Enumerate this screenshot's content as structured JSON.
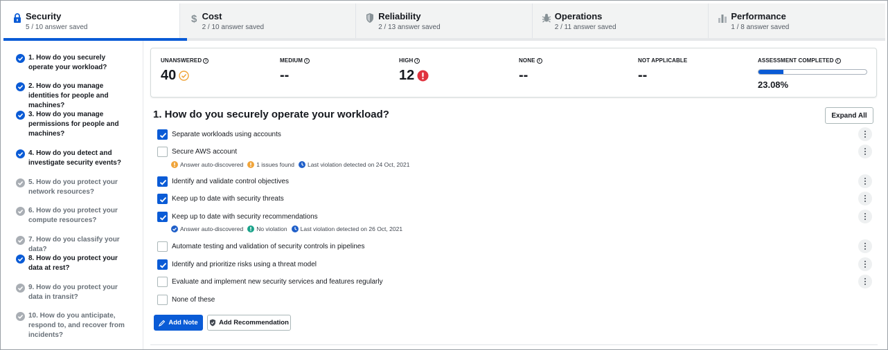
{
  "tabs": [
    {
      "title": "Security",
      "sub": "5 / 10 answer saved",
      "icon": "lock-icon"
    },
    {
      "title": "Cost",
      "sub": "2 / 10 answer saved",
      "icon": "dollar-icon"
    },
    {
      "title": "Reliability",
      "sub": "2 / 13 answer saved",
      "icon": "shield-icon"
    },
    {
      "title": "Operations",
      "sub": "2 / 11 answer saved",
      "icon": "gear-bug-icon"
    },
    {
      "title": "Performance",
      "sub": "1 / 8 answer saved",
      "icon": "bar-chart-icon"
    }
  ],
  "sidebar": {
    "questions": [
      {
        "text": "1. How do you securely operate your workload?",
        "done": true
      },
      {
        "text": "2. How do you manage identities for people and machines?",
        "done": true
      },
      {
        "text": "3. How do you manage permissions for people and machines?",
        "done": true
      },
      {
        "text": "4. How do you detect and investigate security events?",
        "done": true
      },
      {
        "text": "5. How do you protect your network resources?",
        "done": false
      },
      {
        "text": "6. How do you protect your compute resources?",
        "done": false
      },
      {
        "text": "7. How do you classify your data?",
        "done": false
      },
      {
        "text": "8. How do you protect your data at rest?",
        "done": true
      },
      {
        "text": "9. How do you protect your data in transit?",
        "done": false
      },
      {
        "text": "10. How do you anticipate, respond to, and recover from incidents?",
        "done": false
      }
    ]
  },
  "summary": {
    "unanswered": {
      "label": "UNANSWERED",
      "value": "40"
    },
    "medium": {
      "label": "MEDIUM",
      "value": "--"
    },
    "high": {
      "label": "HIGH",
      "value": "12"
    },
    "none": {
      "label": "NONE",
      "value": "--"
    },
    "not_applicable": {
      "label": "NOT APPLICABLE",
      "value": "--"
    },
    "assessment": {
      "label": "ASSESSMENT COMPLETED",
      "percent": 23.08,
      "percent_text": "23.08%"
    }
  },
  "main": {
    "title": "1. How do you securely operate your workload?",
    "expand_label": "Expand All",
    "choices": [
      {
        "label": "Separate workloads using accounts",
        "checked": true
      },
      {
        "label": "Secure AWS account",
        "checked": false
      },
      {
        "label": "Identify and validate control objectives",
        "checked": true
      },
      {
        "label": "Keep up to date with security threats",
        "checked": true
      },
      {
        "label": "Keep up to date with security recommendations",
        "checked": true
      },
      {
        "label": "Automate testing and validation of security controls in pipelines",
        "checked": false
      },
      {
        "label": "Identify and prioritize risks using a threat model",
        "checked": true
      },
      {
        "label": "Evaluate and implement new security services and features regularly",
        "checked": false
      },
      {
        "label": "None of these",
        "checked": false
      }
    ],
    "meta_secure_account": {
      "auto": "Answer auto-discovered",
      "issues": "1 issues found",
      "last": "Last violation detected on 24 Oct, 2021"
    },
    "meta_recommendations": {
      "auto": "Answer auto-discovered",
      "issues": "No violation",
      "last": "Last violation detected on 26 Oct, 2021"
    },
    "add_note_label": "Add Note",
    "add_rec_label": "Add Recommendation"
  },
  "colors": {
    "accent": "#0a5bd6",
    "warning": "#f0a43a",
    "danger": "#e0333f",
    "success": "#1aa38a"
  }
}
